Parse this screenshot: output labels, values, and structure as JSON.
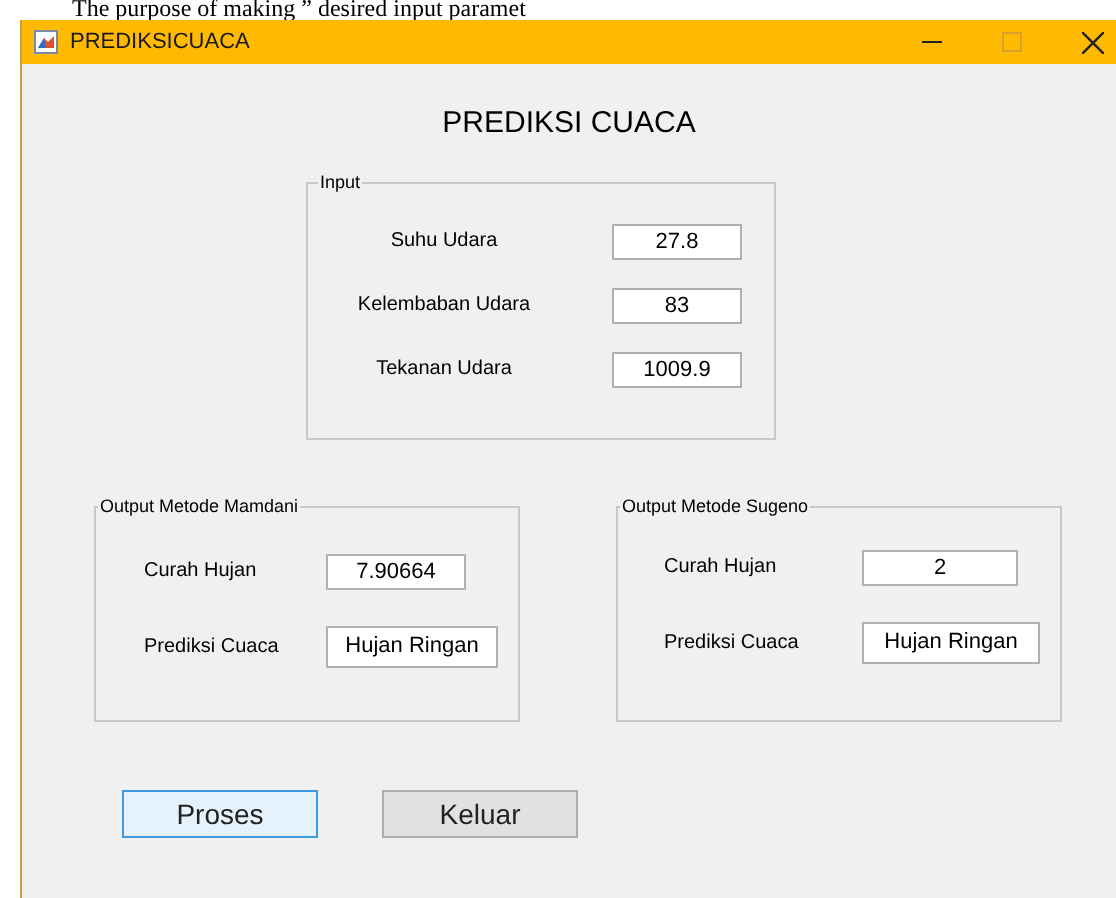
{
  "document_text": "The purpose of making ” desired input paramet",
  "window": {
    "title": "PREDIKSICUACA"
  },
  "heading": "PREDIKSI CUACA",
  "input_panel": {
    "title": "Input",
    "fields": [
      {
        "label": "Suhu Udara",
        "value": "27.8"
      },
      {
        "label": "Kelembaban Udara",
        "value": "83"
      },
      {
        "label": "Tekanan Udara",
        "value": "1009.9"
      }
    ]
  },
  "output_panels": [
    {
      "title": "Output Metode Mamdani",
      "fields": [
        {
          "label": "Curah Hujan",
          "value": "7.90664"
        },
        {
          "label": "Prediksi Cuaca",
          "value": "Hujan Ringan"
        }
      ]
    },
    {
      "title": "Output Metode Sugeno",
      "fields": [
        {
          "label": "Curah Hujan",
          "value": "2"
        },
        {
          "label": "Prediksi Cuaca",
          "value": "Hujan Ringan"
        }
      ]
    }
  ],
  "buttons": [
    {
      "label": "Proses",
      "focused": true
    },
    {
      "label": "Keluar",
      "focused": false
    }
  ]
}
